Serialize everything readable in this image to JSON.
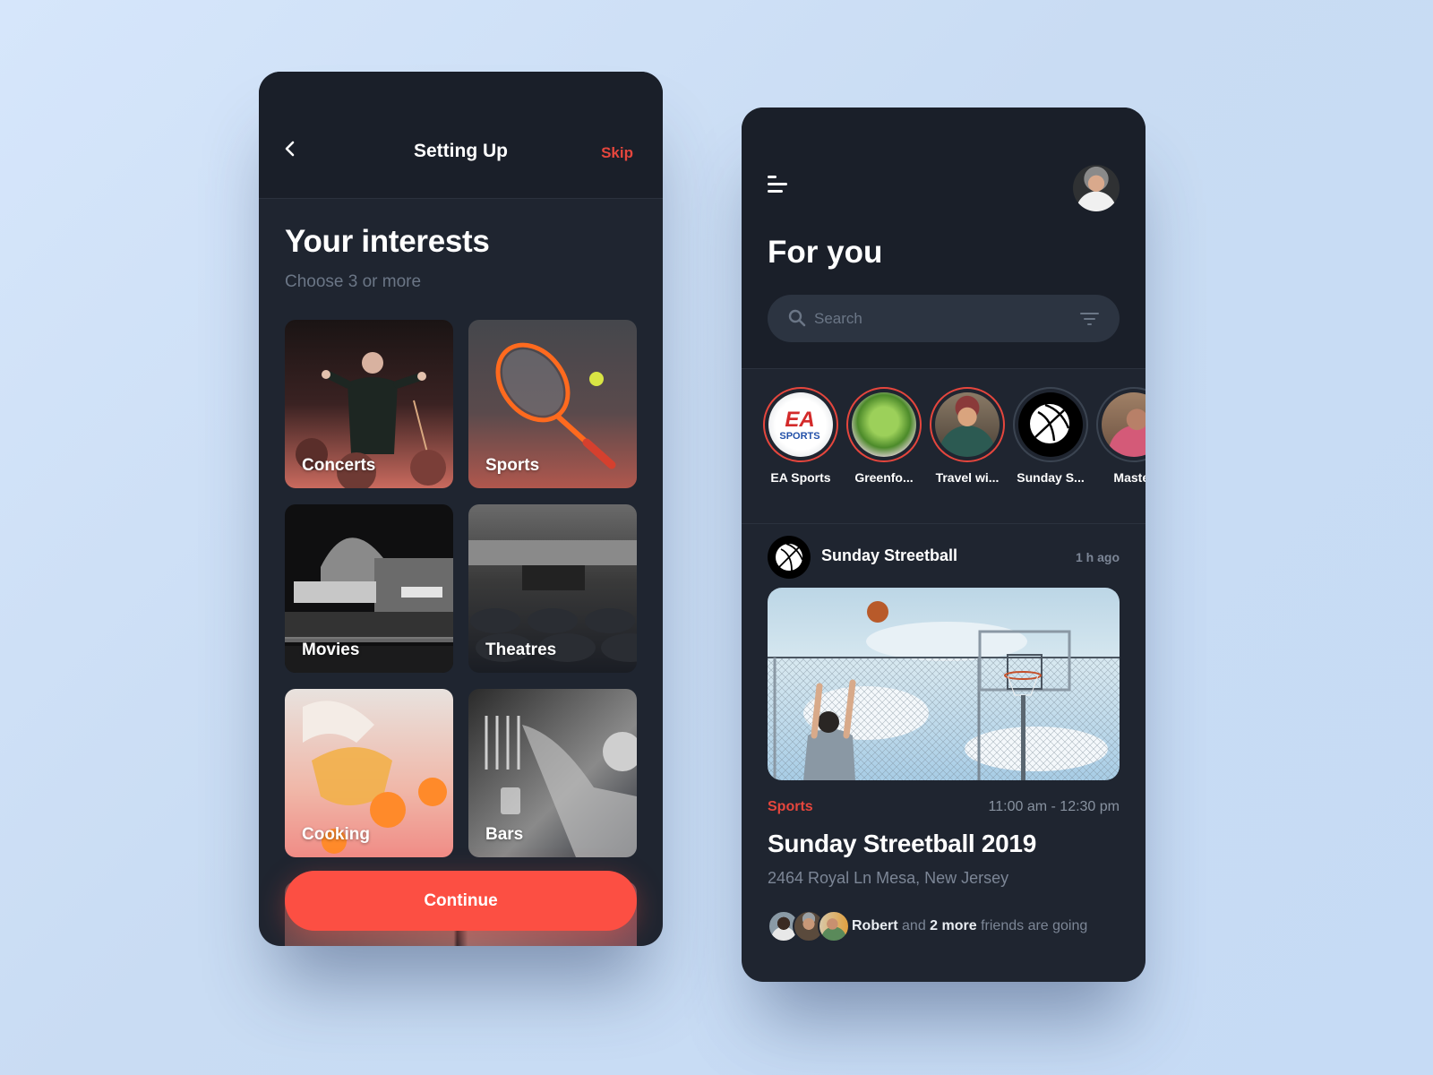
{
  "setup_screen": {
    "header": {
      "back_icon": "chevron-left-icon",
      "title": "Setting Up",
      "skip_label": "Skip"
    },
    "heading": "Your interests",
    "subheading": "Choose 3 or more",
    "interests": [
      {
        "label": "Concerts",
        "image": "orchestra-conductor"
      },
      {
        "label": "Sports",
        "image": "tennis-racket-and-ball"
      },
      {
        "label": "Movies",
        "image": "cinema-marquee"
      },
      {
        "label": "Theatres",
        "image": "theatre-auditorium"
      },
      {
        "label": "Cooking",
        "image": "pouring-soup-into-pumpkins"
      },
      {
        "label": "Bars",
        "image": "bartender-pouring-beer"
      }
    ],
    "continue_label": "Continue"
  },
  "feed_screen": {
    "header": {
      "menu_icon": "hamburger-menu-icon",
      "profile_avatar": "user-avatar"
    },
    "title": "For you",
    "search": {
      "placeholder": "Search",
      "value": "",
      "search_icon": "search-icon",
      "filter_icon": "filter-icon"
    },
    "stories": [
      {
        "label": "EA Sports",
        "unseen": true
      },
      {
        "label": "Greenfo...",
        "unseen": true
      },
      {
        "label": "Travel wi...",
        "unseen": true
      },
      {
        "label": "Sunday S...",
        "unseen": false
      },
      {
        "label": "Master",
        "unseen": false
      }
    ],
    "post": {
      "author": "Sunday Streetball",
      "time_ago": "1 h ago",
      "category": "Sports",
      "hours": "11:00 am - 12:30 pm",
      "title": "Sunday Streetball 2019",
      "address": "2464 Royal Ln Mesa, New Jersey",
      "friends": {
        "name": "Robert",
        "connector": "and",
        "more": "2 more",
        "suffix": "friends are going"
      }
    }
  },
  "colors": {
    "accent": "#fc4f43",
    "accent_text": "#e5463d",
    "card_bg": "#1f2530",
    "header_bg": "#1a1f29",
    "muted_text": "#7c8696"
  }
}
